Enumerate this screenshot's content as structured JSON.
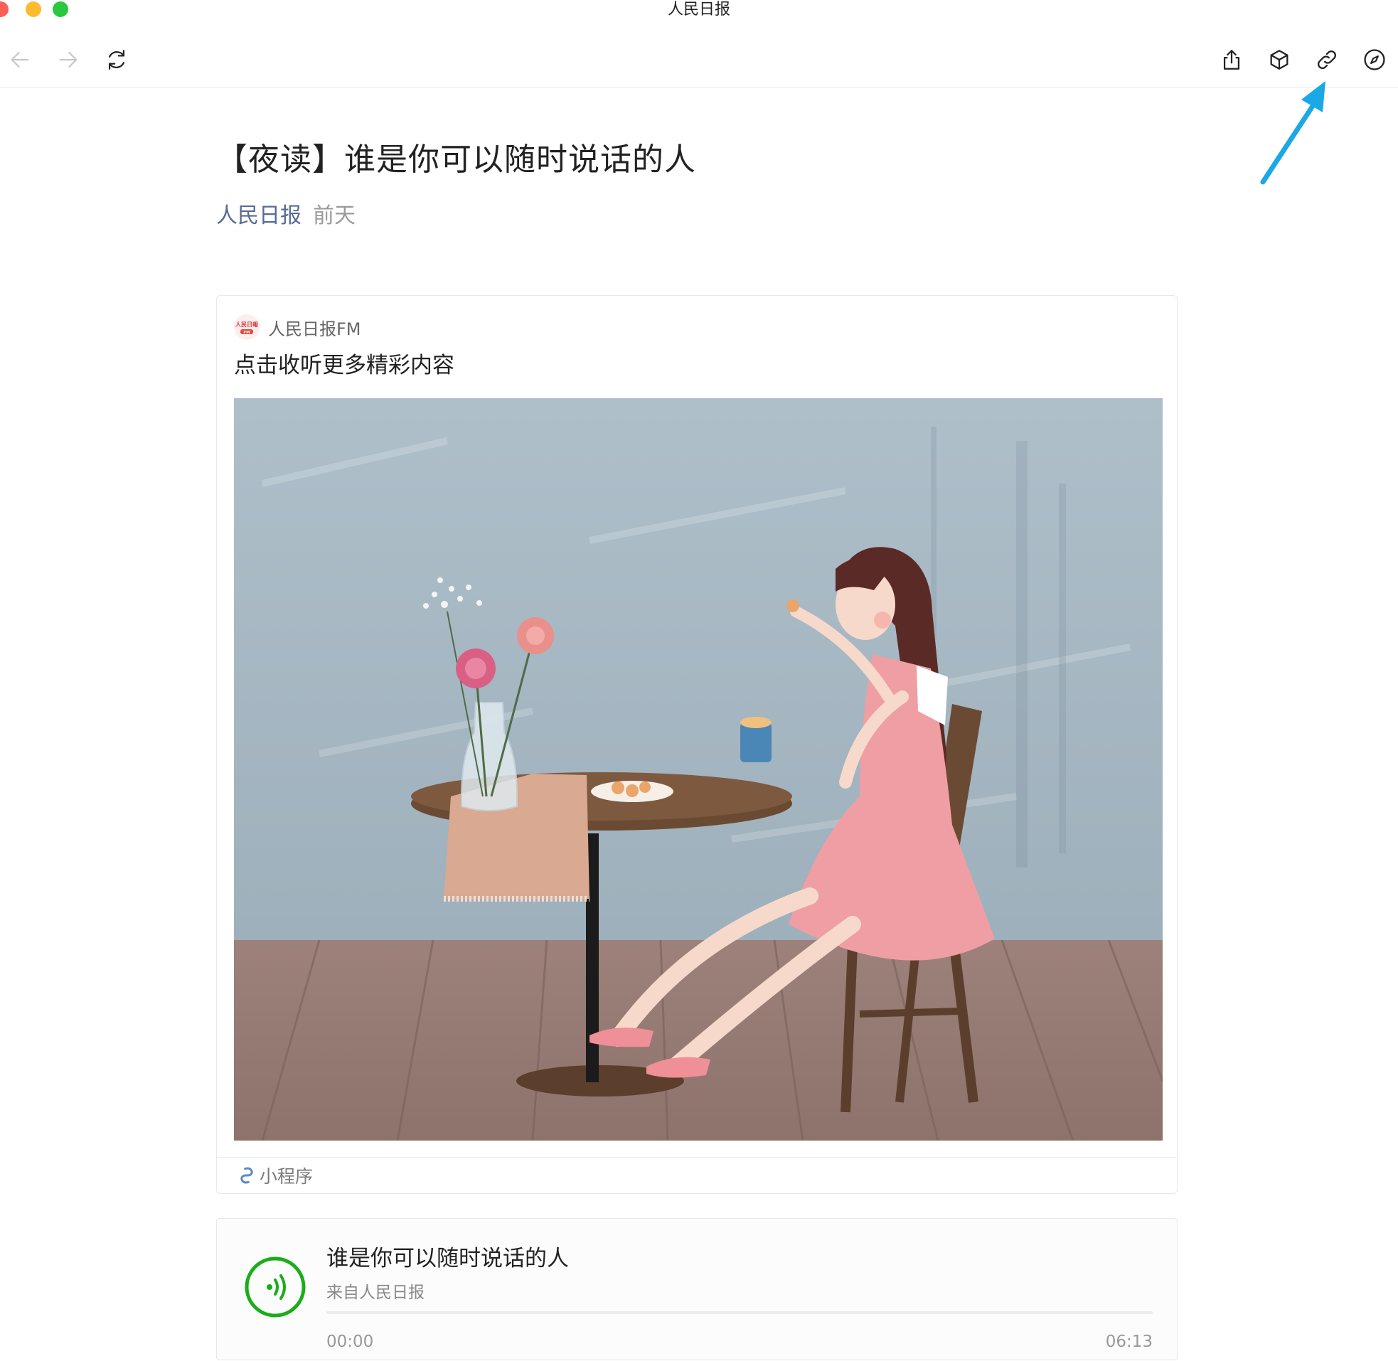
{
  "window": {
    "title": "人民日报"
  },
  "toolbar": {
    "back_icon": "arrow-left-icon",
    "forward_icon": "arrow-right-icon",
    "refresh_icon": "refresh-icon",
    "share_icon": "share-icon",
    "box_icon": "cube-icon",
    "link_icon": "link-icon",
    "compass_icon": "compass-icon"
  },
  "article": {
    "title": "【夜读】谁是你可以随时说话的人",
    "author": "人民日报",
    "date": "前天"
  },
  "mini_program": {
    "name": "人民日报FM",
    "description": "点击收听更多精彩内容",
    "footer_label": "小程序",
    "logo_text": "人民日报"
  },
  "audio": {
    "title": "谁是你可以随时说话的人",
    "source": "来自人民日报",
    "current_time": "00:00",
    "total_time": "06:13",
    "progress": 0
  },
  "colors": {
    "accent_blue": "#576b95",
    "audio_green": "#1aad19",
    "annotation_arrow": "#1aa8e6"
  }
}
